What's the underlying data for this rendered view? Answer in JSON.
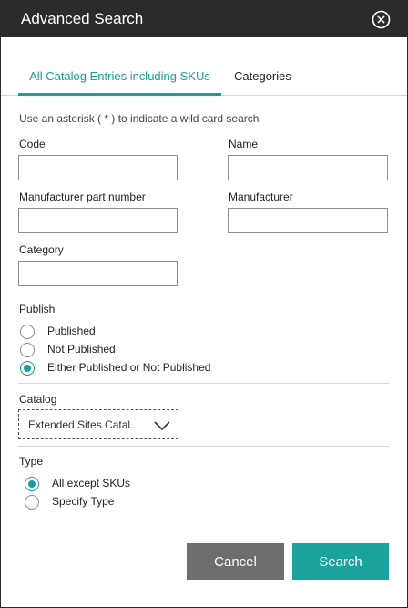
{
  "header": {
    "title": "Advanced Search",
    "close_icon": "close-circle-icon"
  },
  "tabs": [
    {
      "label": "All Catalog Entries including SKUs",
      "active": true
    },
    {
      "label": "Categories",
      "active": false
    }
  ],
  "hint": "Use an asterisk ( * ) to indicate a wild card search",
  "fields": {
    "code": {
      "label": "Code",
      "value": ""
    },
    "name": {
      "label": "Name",
      "value": ""
    },
    "manufacturer_part_number": {
      "label": "Manufacturer part number",
      "value": ""
    },
    "manufacturer": {
      "label": "Manufacturer",
      "value": ""
    },
    "category": {
      "label": "Category",
      "value": ""
    }
  },
  "publish": {
    "label": "Publish",
    "options": [
      "Published",
      "Not Published",
      "Either Published or Not Published"
    ],
    "selected": "Either Published or Not Published"
  },
  "catalog": {
    "label": "Catalog",
    "selected_value": "Extended Sites Catal...",
    "icon": "chevron-down-icon"
  },
  "type": {
    "label": "Type",
    "options": [
      "All except SKUs",
      "Specify Type"
    ],
    "selected": "All except SKUs"
  },
  "buttons": {
    "cancel": "Cancel",
    "search": "Search"
  },
  "colors": {
    "accent": "#1a9e97",
    "header_bg": "#2b2b2b",
    "cancel_bg": "#6e6e6e"
  }
}
